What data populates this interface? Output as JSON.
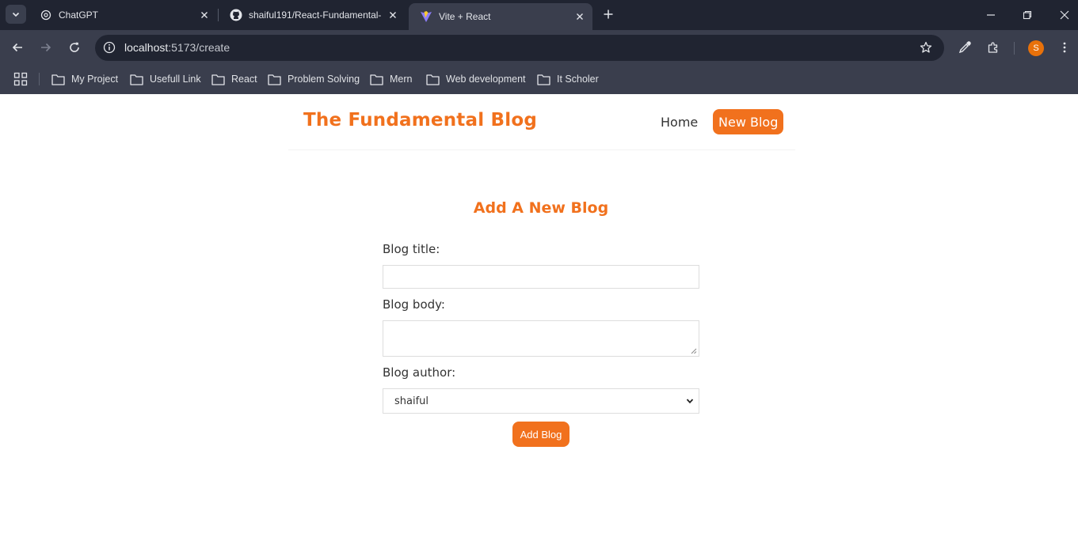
{
  "browser": {
    "tabs": [
      {
        "title": "ChatGPT",
        "icon": "chatgpt-logo-icon",
        "active": false
      },
      {
        "title": "shaiful191/React-Fundamental-",
        "icon": "github-logo-icon",
        "active": false
      },
      {
        "title": "Vite + React",
        "icon": "vite-logo-icon",
        "active": true
      }
    ],
    "address": {
      "host": "localhost",
      "path": ":5173/create"
    },
    "profile_initial": "S",
    "bookmarks": [
      "My Project",
      "Usefull Link",
      "React",
      "Problem Solving",
      "Mern",
      "Web development",
      "It Scholer"
    ],
    "colors": {
      "chrome_dark": "#202431",
      "chrome": "#3a3e4d",
      "profile": "#e8710a"
    }
  },
  "navbar": {
    "brand": "The Fundamental Blog",
    "links": {
      "home": "Home",
      "new_blog": "New Blog"
    }
  },
  "form": {
    "heading": "Add A New Blog",
    "title_label": "Blog title:",
    "title_value": "",
    "body_label": "Blog body:",
    "body_value": "",
    "author_label": "Blog author:",
    "author_selected": "shaiful",
    "submit_label": "Add Blog"
  },
  "theme": {
    "accent": "#f1711d",
    "text": "#333333"
  }
}
